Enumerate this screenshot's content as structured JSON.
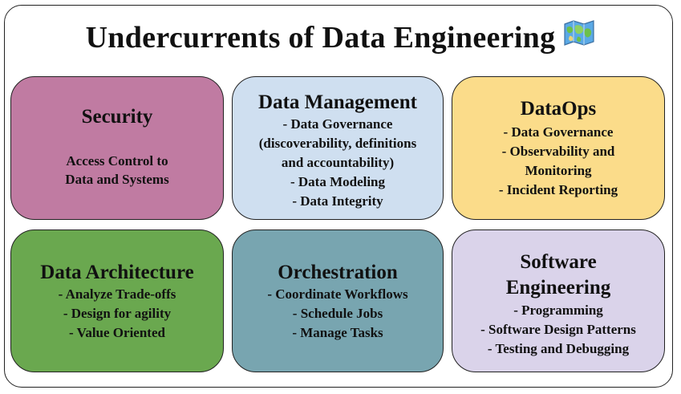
{
  "title": "Undercurrents of Data Engineering",
  "title_icon": "world-map-icon",
  "cards": [
    {
      "heading": "Security",
      "color": "#c07ba2",
      "items": [
        "Access Control to",
        "Data and Systems"
      ]
    },
    {
      "heading": "Data Management",
      "color": "#cfdff0",
      "items": [
        "- Data Governance",
        "(discoverability, definitions",
        "and accountability)",
        "- Data Modeling",
        "- Data Integrity"
      ]
    },
    {
      "heading": "DataOps",
      "color": "#fbdc8a",
      "items": [
        "- Data Governance",
        "- Observability and",
        "Monitoring",
        "- Incident Reporting"
      ]
    },
    {
      "heading": "Data Architecture",
      "color": "#6aa84f",
      "items": [
        "- Analyze Trade-offs",
        "- Design for agility",
        "- Value Oriented"
      ]
    },
    {
      "heading": "Orchestration",
      "color": "#78a5b0",
      "items": [
        "- Coordinate Workflows",
        "- Schedule Jobs",
        "- Manage Tasks"
      ]
    },
    {
      "heading_lines": [
        "Software",
        "Engineering"
      ],
      "color": "#dad3ea",
      "items": [
        "- Programming",
        "- Software Design Patterns",
        "- Testing and Debugging"
      ]
    }
  ]
}
